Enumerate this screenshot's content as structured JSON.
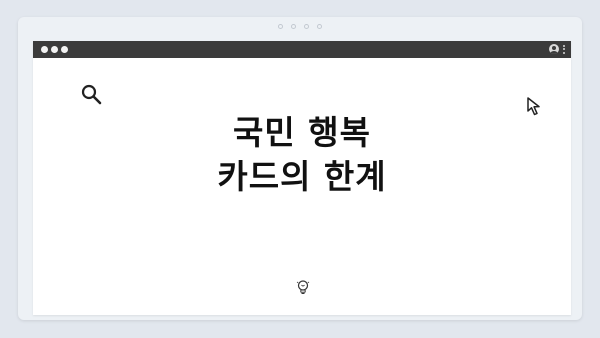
{
  "slide": {
    "title_line1": "국민 행복",
    "title_line2": "카드의 한계"
  },
  "icons": {
    "search": "search-icon",
    "cursor": "cursor-icon",
    "bulb": "lightbulb-icon",
    "user": "user-icon",
    "menu": "kebab-menu-icon"
  },
  "colors": {
    "titlebar": "#3b3b3b",
    "background": "#e2e7ee",
    "window": "#ffffff",
    "text": "#111111"
  }
}
